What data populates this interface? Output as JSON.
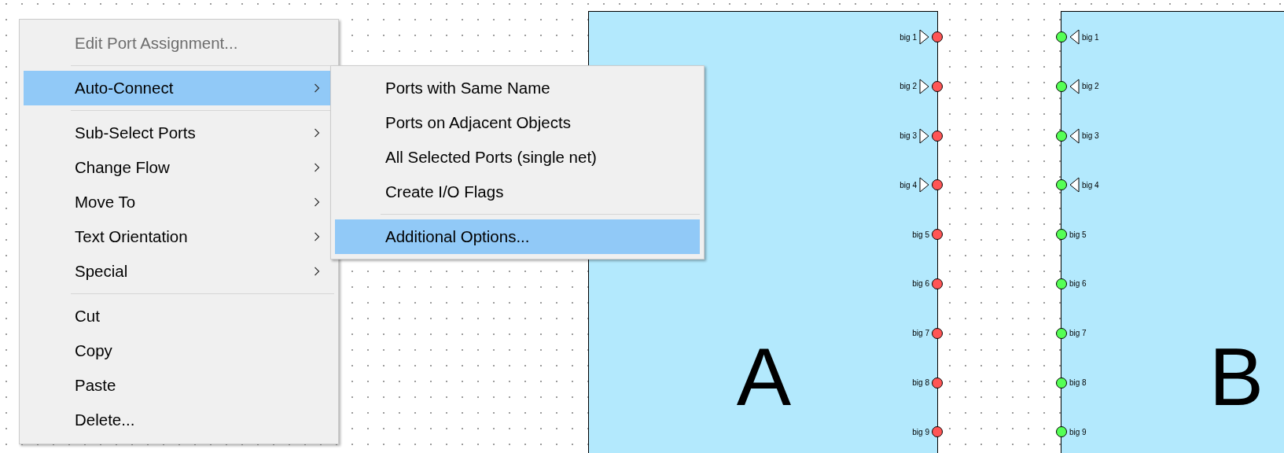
{
  "context_menu": {
    "groups": [
      [
        {
          "label": "Edit Port Assignment...",
          "disabled": true,
          "has_submenu": false,
          "selected": false
        }
      ],
      [
        {
          "label": "Auto-Connect",
          "disabled": false,
          "has_submenu": true,
          "selected": true
        }
      ],
      [
        {
          "label": "Sub-Select Ports",
          "disabled": false,
          "has_submenu": true,
          "selected": false
        },
        {
          "label": "Change Flow",
          "disabled": false,
          "has_submenu": true,
          "selected": false
        },
        {
          "label": "Move To",
          "disabled": false,
          "has_submenu": true,
          "selected": false
        },
        {
          "label": "Text Orientation",
          "disabled": false,
          "has_submenu": true,
          "selected": false
        },
        {
          "label": "Special",
          "disabled": false,
          "has_submenu": true,
          "selected": false
        }
      ],
      [
        {
          "label": "Cut",
          "disabled": false,
          "has_submenu": false,
          "selected": false
        },
        {
          "label": "Copy",
          "disabled": false,
          "has_submenu": false,
          "selected": false
        },
        {
          "label": "Paste",
          "disabled": false,
          "has_submenu": false,
          "selected": false
        },
        {
          "label": "Delete...",
          "disabled": false,
          "has_submenu": false,
          "selected": false
        }
      ]
    ]
  },
  "submenu": {
    "groups": [
      [
        {
          "label": "Ports with Same Name",
          "selected": false
        },
        {
          "label": "Ports on Adjacent Objects",
          "selected": false
        },
        {
          "label": "All Selected Ports (single net)",
          "selected": false
        },
        {
          "label": "Create I/O Flags",
          "selected": false
        }
      ],
      [
        {
          "label": "Additional Options...",
          "selected": true
        }
      ]
    ]
  },
  "blocks": [
    {
      "letter": "A",
      "kind": "right_ports",
      "color": "#ff5555",
      "ports": [
        {
          "label": "big 1",
          "kind": "output"
        },
        {
          "label": "big 2",
          "kind": "output"
        },
        {
          "label": "big 3",
          "kind": "output"
        },
        {
          "label": "big 4",
          "kind": "output"
        },
        {
          "label": "big 5",
          "kind": "plain"
        },
        {
          "label": "big 6",
          "kind": "plain"
        },
        {
          "label": "big 7",
          "kind": "plain"
        },
        {
          "label": "big 8",
          "kind": "plain"
        },
        {
          "label": "big 9",
          "kind": "plain"
        }
      ]
    },
    {
      "letter": "B",
      "kind": "left_ports",
      "color": "#55ff55",
      "ports": [
        {
          "label": "big 1",
          "kind": "input"
        },
        {
          "label": "big 2",
          "kind": "input"
        },
        {
          "label": "big 3",
          "kind": "input"
        },
        {
          "label": "big 4",
          "kind": "input"
        },
        {
          "label": "big 5",
          "kind": "plain"
        },
        {
          "label": "big 6",
          "kind": "plain"
        },
        {
          "label": "big 7",
          "kind": "plain"
        },
        {
          "label": "big 8",
          "kind": "plain"
        },
        {
          "label": "big 9",
          "kind": "plain"
        }
      ]
    }
  ]
}
